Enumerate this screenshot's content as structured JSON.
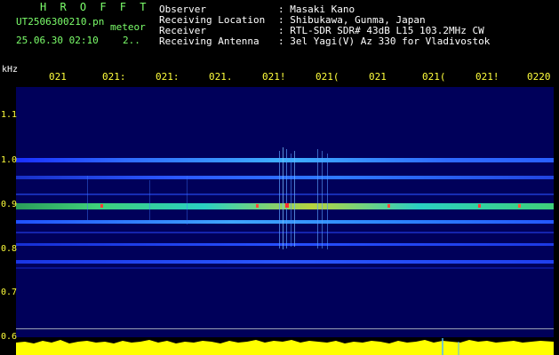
{
  "header": {
    "brand": "H R O F F T",
    "filename": "UT2506300210.pn",
    "meteor_label": "meteor",
    "datetime": "25.06.30 02:10",
    "count": "2..",
    "info": [
      {
        "label": "Observer",
        "value": ": Masaki Kano"
      },
      {
        "label": "Receiving Location",
        "value": ": Shibukawa, Gunma, Japan"
      },
      {
        "label": "Receiver",
        "value": ": RTL-SDR SDR# 43dB L15 103.2MHz CW"
      },
      {
        "label": "Receiving Antenna",
        "value": ": 3el Yagi(V) Az 330 for Vladivostok"
      }
    ]
  },
  "axis": {
    "y_unit": "kHz",
    "y_ticks": [
      "1.1",
      "1.0",
      "0.9",
      "0.8",
      "0.7",
      "0.6"
    ],
    "time_ticks": [
      "021",
      "021:",
      "021:",
      "021.",
      "021!",
      "021(",
      "021",
      "021(",
      "021!",
      "0220"
    ]
  },
  "colors": {
    "background": "#000000",
    "plot_background": "#00005a",
    "brand_text": "#7cff6b",
    "label_text": "#ffffff",
    "tick_text": "#ffff3c",
    "noise_fill": "#ffff00"
  }
}
